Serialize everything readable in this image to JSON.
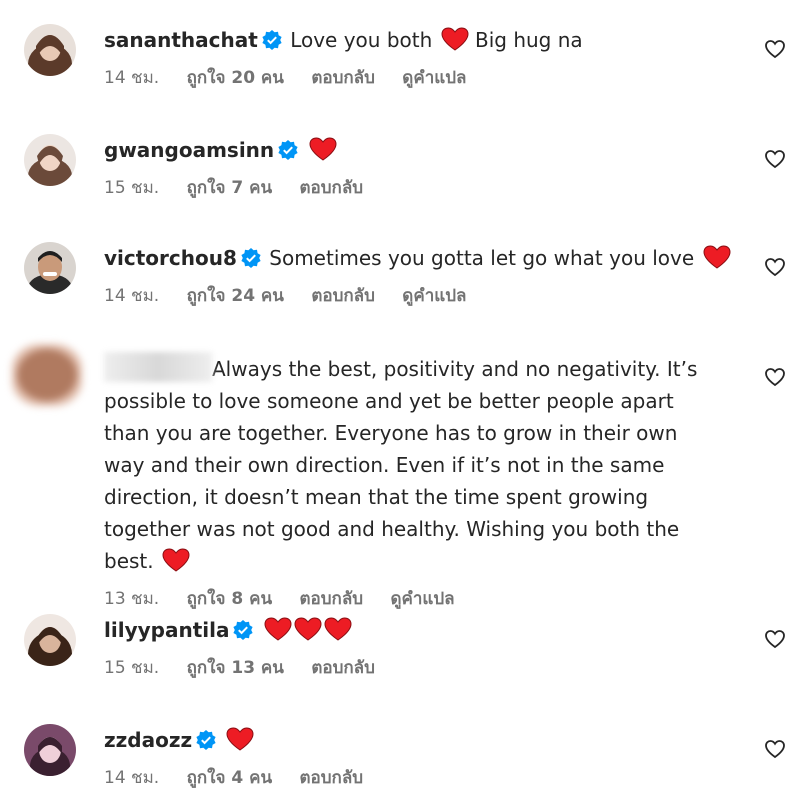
{
  "comments": [
    {
      "username": "sanantha­chat",
      "text": "Love you both",
      "text2": "Big hug na",
      "time": "14 ชม.",
      "likes": "ถูกใจ 20 คน",
      "reply": "ตอบกลับ",
      "translate": "ดูคำแปล",
      "avatar_colors": [
        "#5b3a2a",
        "#e8c9b5"
      ]
    },
    {
      "username": "gwangoamsinn",
      "text": "",
      "time": "15 ชม.",
      "likes": "ถูกใจ 7 คน",
      "reply": "ตอบกลับ",
      "avatar_colors": [
        "#6b4a3a",
        "#f0d5c5"
      ]
    },
    {
      "username": "victorchou8",
      "text": "Sometimes you gotta let go what you love",
      "time": "14 ชม.",
      "likes": "ถูกใจ 24 คน",
      "reply": "ตอบกลับ",
      "translate": "ดูคำแปล",
      "avatar_colors": [
        "#1f1f1f",
        "#c99a7a"
      ]
    },
    {
      "username": "",
      "text": "Always the best, positivity and no negativity. It’s possible to love someone and yet be better people apart than you are together. Everyone has to grow in their own way and their own direction. Even if it’s not in the same direction, it doesn’t mean that the time spent growing together was not good and healthy. Wishing you both the best.",
      "time": "13 ชม.",
      "likes": "ถูกใจ 8 คน",
      "reply": "ตอบกลับ",
      "translate": "ดูคำแปล",
      "avatar_colors": [
        "#b07a60",
        "#e2bfae"
      ]
    },
    {
      "username": "lilyypantila",
      "text": "",
      "time": "15 ชม.",
      "likes": "ถูกใจ 13 คน",
      "reply": "ตอบกลับ",
      "avatar_colors": [
        "#3a2418",
        "#d9b49c"
      ]
    },
    {
      "username": "zzdaozz",
      "text": "",
      "time": "14 ชม.",
      "likes": "ถูกใจ 4 คน",
      "reply": "ตอบกลับ",
      "avatar_colors": [
        "#7a4a6a",
        "#efcfd9"
      ]
    }
  ],
  "colors": {
    "verified": "#0095f6",
    "heart": "#ed1c24",
    "meta": "#737373"
  }
}
